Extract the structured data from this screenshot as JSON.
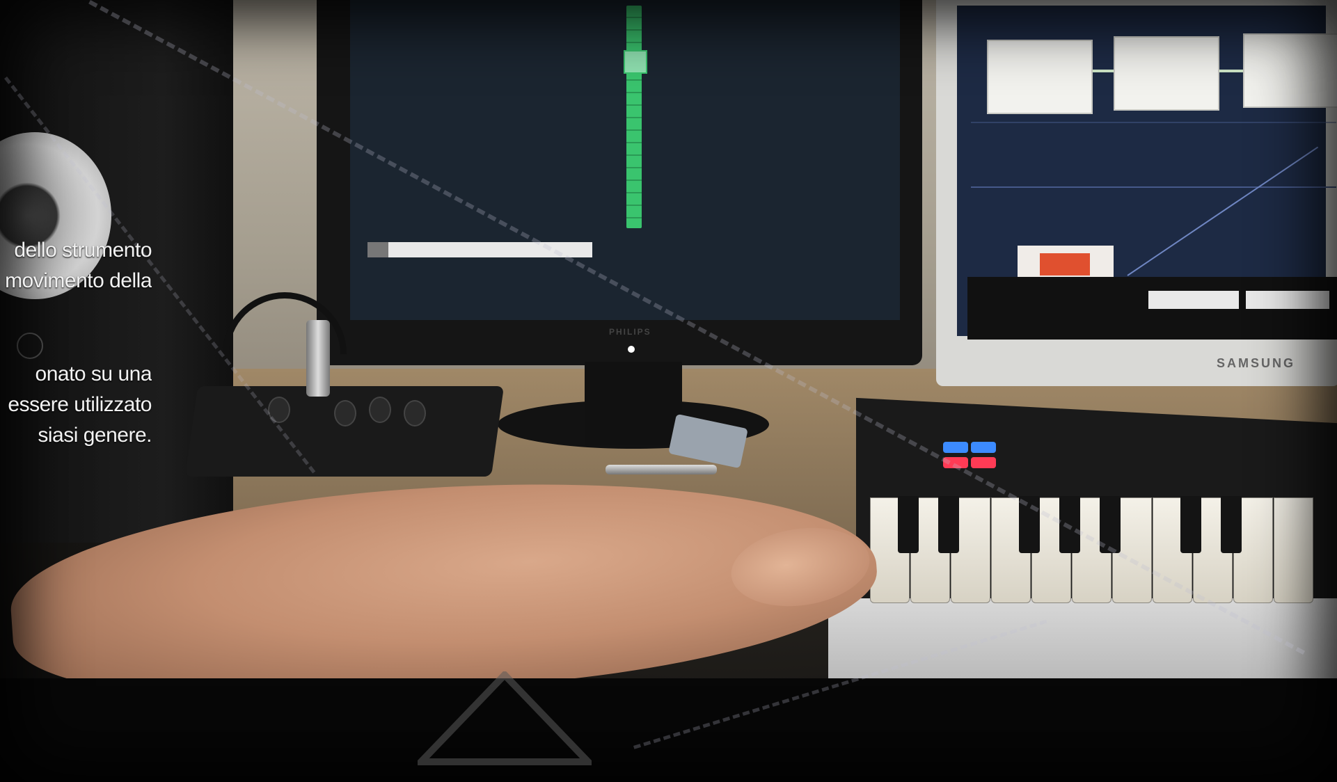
{
  "overlay": {
    "block1": {
      "line1": "dello strumento",
      "line2": "movimento  della"
    },
    "block2": {
      "line1": "onato   su   una",
      "line2": "essere utilizzato",
      "line3": "siasi genere."
    }
  },
  "scene": {
    "main_monitor_brand": "PHILIPS",
    "side_monitor_brand": "SAMSUNG"
  },
  "colors": {
    "level_meter": "#3ac46e",
    "daw_background": "#1d2a44",
    "red_indicator": "#e0502f",
    "pad_blue": "#3c8bff",
    "pad_red": "#ff3b55"
  }
}
